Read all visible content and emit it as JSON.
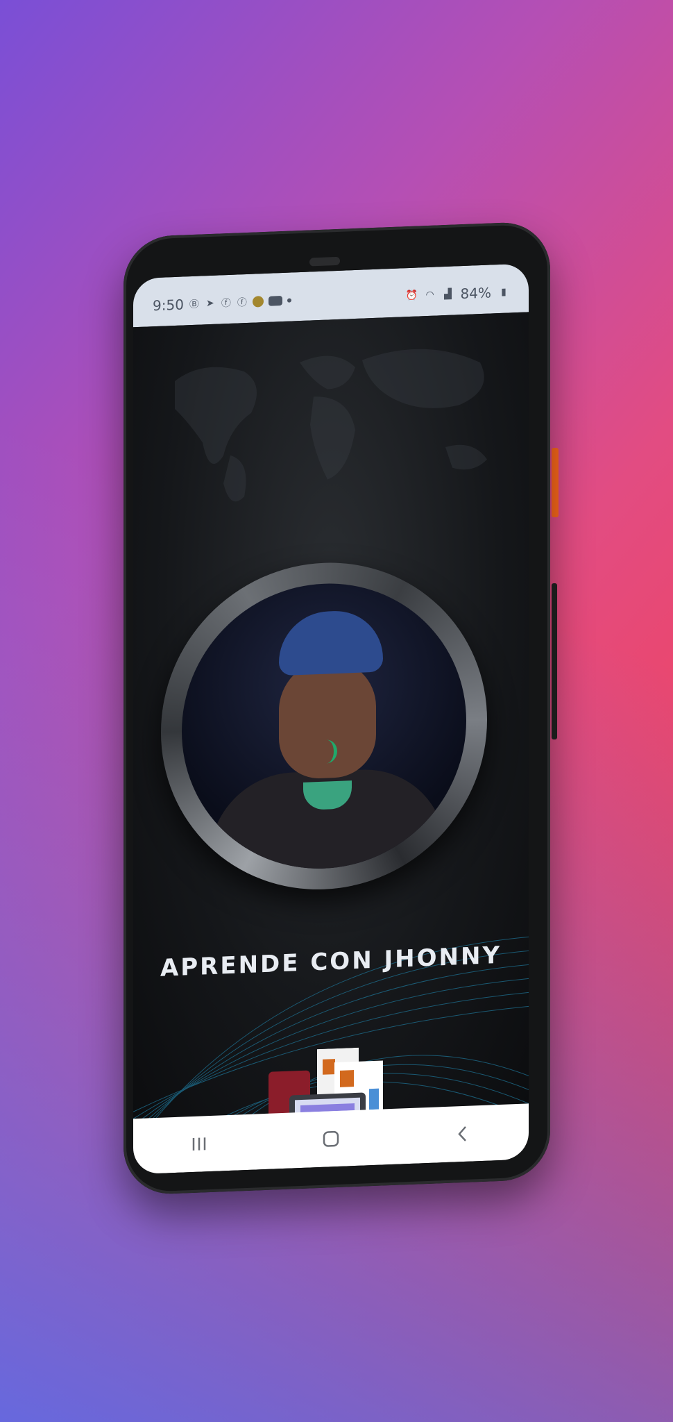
{
  "status_bar": {
    "time": "9:50",
    "battery": "84%"
  },
  "app": {
    "title": "APRENDE CON JHONNY"
  },
  "icons": {
    "status_left": [
      "b-icon",
      "telegram-icon",
      "facebook-icon",
      "facebook-icon",
      "app-icon",
      "youtube-icon",
      "dot-icon"
    ],
    "status_right": [
      "alarm-icon",
      "wifi-icon",
      "signal-icon",
      "battery-icon"
    ],
    "nav": [
      "recents-icon",
      "home-icon",
      "back-icon"
    ]
  },
  "colors": {
    "bg_start": "#7a4fd6",
    "bg_end": "#ff3a3a",
    "accent_green": "#20a86b",
    "side_button": "#ff6a1a"
  }
}
